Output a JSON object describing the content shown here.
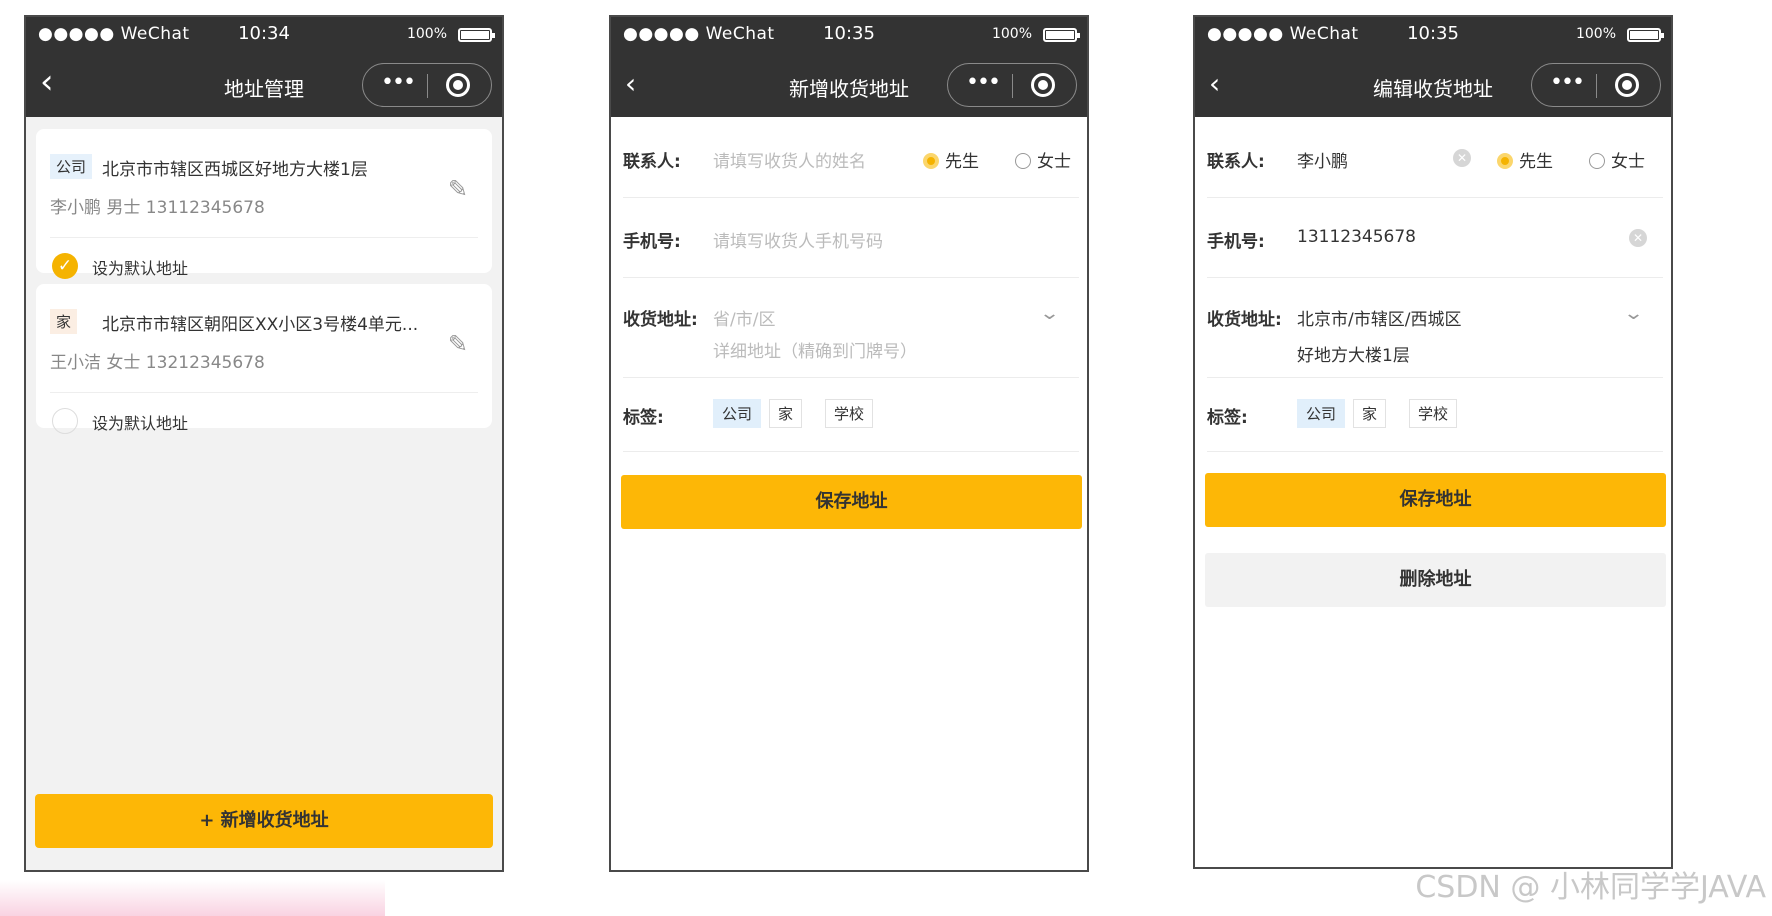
{
  "status": {
    "carrier": "●●●●● WeChat",
    "battery": "100%"
  },
  "phone1": {
    "time": "10:34",
    "title": "地址管理",
    "addresses": [
      {
        "tag": "公司",
        "address": "北京市市辖区西城区好地方大楼1层",
        "contact": "李小鹏 男士  13112345678",
        "default_label": "设为默认地址",
        "is_default": true
      },
      {
        "tag": "家",
        "address": "北京市市辖区朝阳区XX小区3号楼4单元...",
        "contact": "王小洁 女士  13212345678",
        "default_label": "设为默认地址",
        "is_default": false
      }
    ],
    "add_button": "+ 新增收货地址"
  },
  "phone2": {
    "time": "10:35",
    "title": "新增收货地址",
    "contact_label": "联系人:",
    "contact_placeholder": "请填写收货人的姓名",
    "gender_male": "先生",
    "gender_female": "女士",
    "phone_label": "手机号:",
    "phone_placeholder": "请填写收货人手机号码",
    "address_label": "收货地址:",
    "region_placeholder": "省/市/区",
    "detail_placeholder": "详细地址（精确到门牌号）",
    "tag_label": "标签:",
    "tags": [
      "公司",
      "家",
      "学校"
    ],
    "save_button": "保存地址"
  },
  "phone3": {
    "time": "10:35",
    "title": "编辑收货地址",
    "contact_label": "联系人:",
    "contact_value": "李小鹏",
    "gender_male": "先生",
    "gender_female": "女士",
    "phone_label": "手机号:",
    "phone_value": "13112345678",
    "address_label": "收货地址:",
    "region_value": "北京市/市辖区/西城区",
    "detail_value": "好地方大楼1层",
    "tag_label": "标签:",
    "tags": [
      "公司",
      "家",
      "学校"
    ],
    "save_button": "保存地址",
    "delete_button": "删除地址"
  },
  "watermark": "CSDN @ 小林同学学JAVA",
  "colors": {
    "accent": "#fdb706",
    "navbar": "#333333",
    "tag_company": "#e6f1fb",
    "tag_home": "#fbeee3"
  }
}
